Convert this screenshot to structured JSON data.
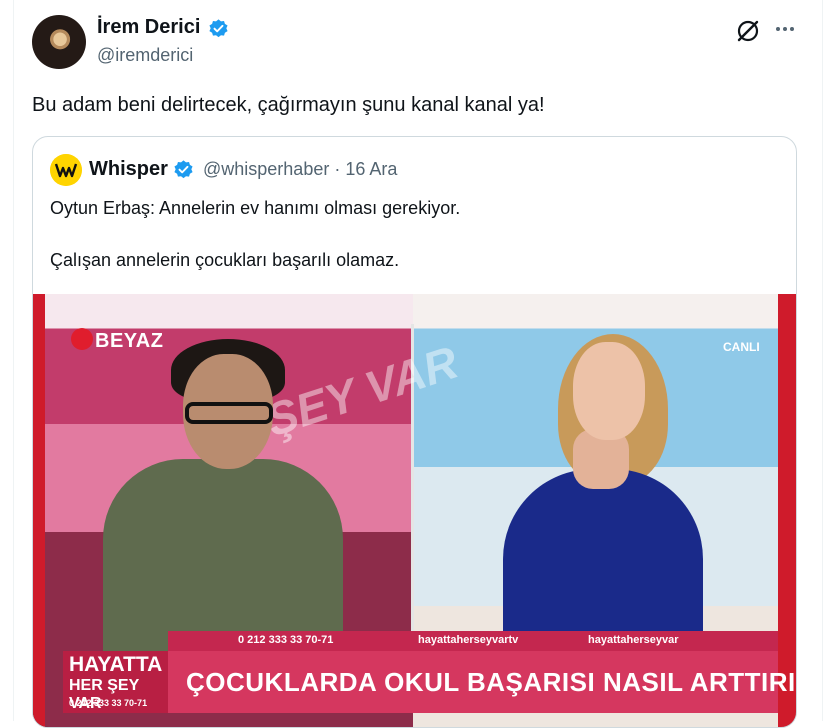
{
  "author": {
    "display_name": "İrem Derici",
    "handle": "@iremderici"
  },
  "tweet": {
    "text": "Bu adam beni delirtecek, çağırmayın şunu kanal kanal ya!"
  },
  "icons": {
    "verified": "verified-badge-icon",
    "grok": "grok-icon",
    "more": "more-options-icon"
  },
  "quote": {
    "name": "Whisper",
    "handle": "@whisperhaber",
    "separator": "·",
    "date": "16 Ara",
    "line1": "Oytun Erbaş: Annelerin ev hanımı olması gerekiyor.",
    "line2": "Çalışan annelerin çocukları başarılı olamaz."
  },
  "video": {
    "channel": "BEYAZ",
    "background_text": "ŞEY VAR",
    "live_label": "CANLI",
    "phone": "0 212 333 33 70-71",
    "instagram": "hayattaherseyvartv",
    "youtube": "hayattaherseyvar",
    "headline": "ÇOCUKLARDA OKUL BAŞARISI NASIL ARTTIRILIR?",
    "show_logo_line1": "HAYATTA",
    "show_logo_line2": "HER ŞEY VAR",
    "show_logo_phone": "0 212 333 33 70-71"
  },
  "colors": {
    "verified_blue": "#1d9bf0",
    "whisper_yellow": "#ffd400",
    "secondary_text": "#536471",
    "lower_third": "#d5375f"
  }
}
